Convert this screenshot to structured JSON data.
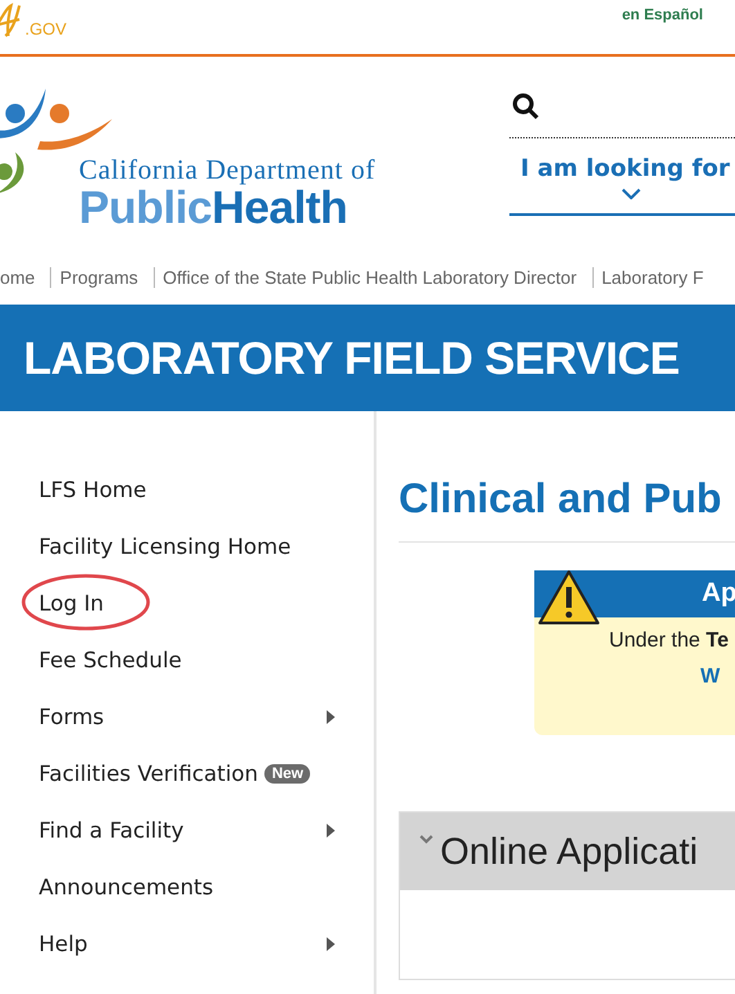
{
  "top_bar": {
    "gov_logo": ".GOV",
    "language_link": "en Español"
  },
  "logo": {
    "line1": "California Department of",
    "word1": "Public",
    "word2": "Health"
  },
  "search": {
    "looking_for": "I am looking for"
  },
  "breadcrumbs": [
    "ome",
    "Programs",
    "Office of the State Public Health Laboratory Director",
    "Laboratory F"
  ],
  "banner": {
    "title": "LABORATORY FIELD SERVICE"
  },
  "sidebar": {
    "items": [
      {
        "label": "LFS Home",
        "submenu": false,
        "circled": false
      },
      {
        "label": "Facility Licensing Home",
        "submenu": false,
        "circled": false
      },
      {
        "label": "Log In",
        "submenu": false,
        "circled": true
      },
      {
        "label": "Fee Schedule",
        "submenu": false,
        "circled": false
      },
      {
        "label": "Forms",
        "submenu": true,
        "circled": false
      },
      {
        "label": "Facilities Verification",
        "badge": "New",
        "submenu": false,
        "circled": false
      },
      {
        "label": "Find a Facility",
        "submenu": true,
        "circled": false
      },
      {
        "label": "Announcements",
        "submenu": false,
        "circled": false
      },
      {
        "label": "Help",
        "submenu": true,
        "circled": false
      }
    ]
  },
  "main": {
    "heading": "Clinical and Pub",
    "alert": {
      "title": "Ap",
      "text": "Under the **Te**",
      "link": "W"
    },
    "accordion": {
      "title": "Online Applicati",
      "expanded": true
    }
  }
}
